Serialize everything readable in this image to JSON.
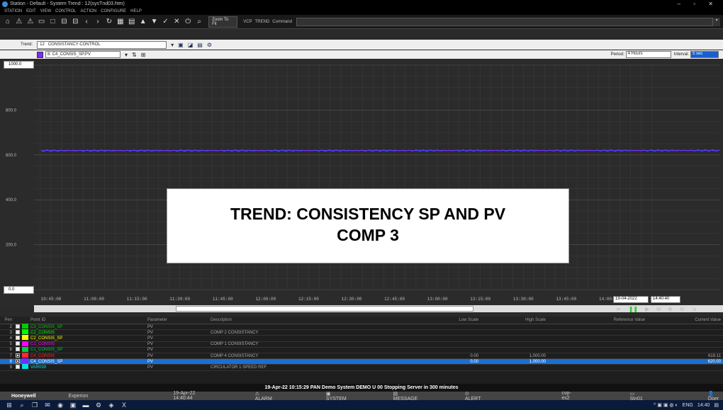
{
  "window": {
    "title": "Station - Default - System Trend : 12(sysTnd03.htm)",
    "controls": "– ▫ ✕"
  },
  "menu": [
    "STATION",
    "EDIT",
    "VIEW",
    "CONTROL",
    "ACTION",
    "CONFIGURE",
    "HELP"
  ],
  "toolbar": {
    "zoom": "Zoom To Fit",
    "vcp": "VCP",
    "trend": "TREND",
    "command": "Command"
  },
  "trend": {
    "label": "Trend:",
    "number": "12",
    "name": "CONSISTANCY CONTROL"
  },
  "pen": {
    "selected": "8: C4_CONSIS_SP.PV",
    "period_label": "Period:",
    "period": "4 Hours",
    "interval_label": "Interval:",
    "interval": "5 sec",
    "color": "#7b2cff"
  },
  "chart_data": {
    "type": "line",
    "ylim": [
      0,
      1000
    ],
    "yticks": [
      "1000.0",
      "800.0",
      "600.0",
      "400.0",
      "200.0",
      "0.0"
    ],
    "yvals": [
      1000,
      800,
      600,
      400,
      200,
      0
    ],
    "xticks": [
      "10:45:00",
      "11:00:00",
      "11:15:00",
      "11:30:00",
      "11:45:00",
      "12:00:00",
      "12:15:00",
      "12:30:00",
      "12:45:00",
      "13:00:00",
      "13:15:00",
      "13:30:00",
      "13:45:00",
      "14:00:00",
      "14:15:00"
    ],
    "series": [
      {
        "name": "C4_CONSIS_SP",
        "color": "#2a4cff",
        "values": [
          620,
          620
        ]
      },
      {
        "name": "C4_CONSIS",
        "color": "#7b2cff",
        "values": [
          619,
          620
        ]
      }
    ]
  },
  "overlay": {
    "line1": "TREND: CONSISTENCY SP AND PV",
    "line2": "COMP 3"
  },
  "datetime": {
    "date": "19-04-2022",
    "time": "14:40:40"
  },
  "table": {
    "headers": {
      "pen": "Pen",
      "point": "Point ID",
      "param": "Parameter",
      "desc": "Description",
      "low": "Low Scale",
      "high": "High Scale",
      "ref": "Reference Value",
      "current": "Current Value"
    },
    "rows": [
      {
        "pen": "2",
        "color": "#00cc00",
        "point": "C3_CONSIS_SP",
        "param": "PV",
        "desc": "",
        "low": "",
        "high": "",
        "current": "",
        "checked": false
      },
      {
        "pen": "3",
        "color": "#00ff00",
        "point": "C2_CONSIS",
        "param": "PV",
        "desc": "COMP 2 CONSISTANCY",
        "low": "",
        "high": "",
        "current": "",
        "checked": false
      },
      {
        "pen": "4",
        "color": "#ffff00",
        "point": "C2_CONSIS_SP",
        "param": "PV",
        "desc": "",
        "low": "",
        "high": "",
        "current": "",
        "checked": false
      },
      {
        "pen": "5",
        "color": "#ff00ff",
        "point": "C1_CONSIS",
        "param": "PV",
        "desc": "COMP 1 CONSISTANCY",
        "low": "",
        "high": "",
        "current": "",
        "checked": false
      },
      {
        "pen": "6",
        "color": "#00cc44",
        "point": "C1_CONSIS_SP",
        "param": "PV",
        "desc": "",
        "low": "",
        "high": "",
        "current": "",
        "checked": false
      },
      {
        "pen": "7",
        "color": "#ff2a2a",
        "point": "C4_CONSIS",
        "param": "PV",
        "desc": "COMP 4 CONSISTANCY",
        "low": "0.00",
        "high": "1,000.00",
        "current": "619.11",
        "checked": true
      },
      {
        "pen": "8",
        "color": "#7b2cff",
        "point": "C4_CONSIS_SP",
        "param": "PV",
        "desc": "",
        "low": "0.00",
        "high": "1,000.00",
        "current": "620.00",
        "checked": true,
        "selected": true
      },
      {
        "pen": "9",
        "color": "#00e0e0",
        "point": "VAR039",
        "param": "PV",
        "desc": "CIRCULATOR 1 SPEED REF",
        "low": "",
        "high": "",
        "current": "",
        "checked": false
      }
    ]
  },
  "status": "19-Apr-22  10:15:29  PAN  Demo System  DEMO  U 00 Stopping Server in 300 minutes",
  "footer": {
    "brand": "Honeywell",
    "experion": "Experion",
    "datetime": "19-Apr-22  14:40:44",
    "alarm": "ALARM",
    "system": "SYSTEM",
    "message": "MESSAGE",
    "alert": "ALERT",
    "server": "cvp-es2",
    "station": "Stn01",
    "user": "Oper"
  },
  "taskbar": {
    "lang": "ENG",
    "clock": "14:40"
  }
}
